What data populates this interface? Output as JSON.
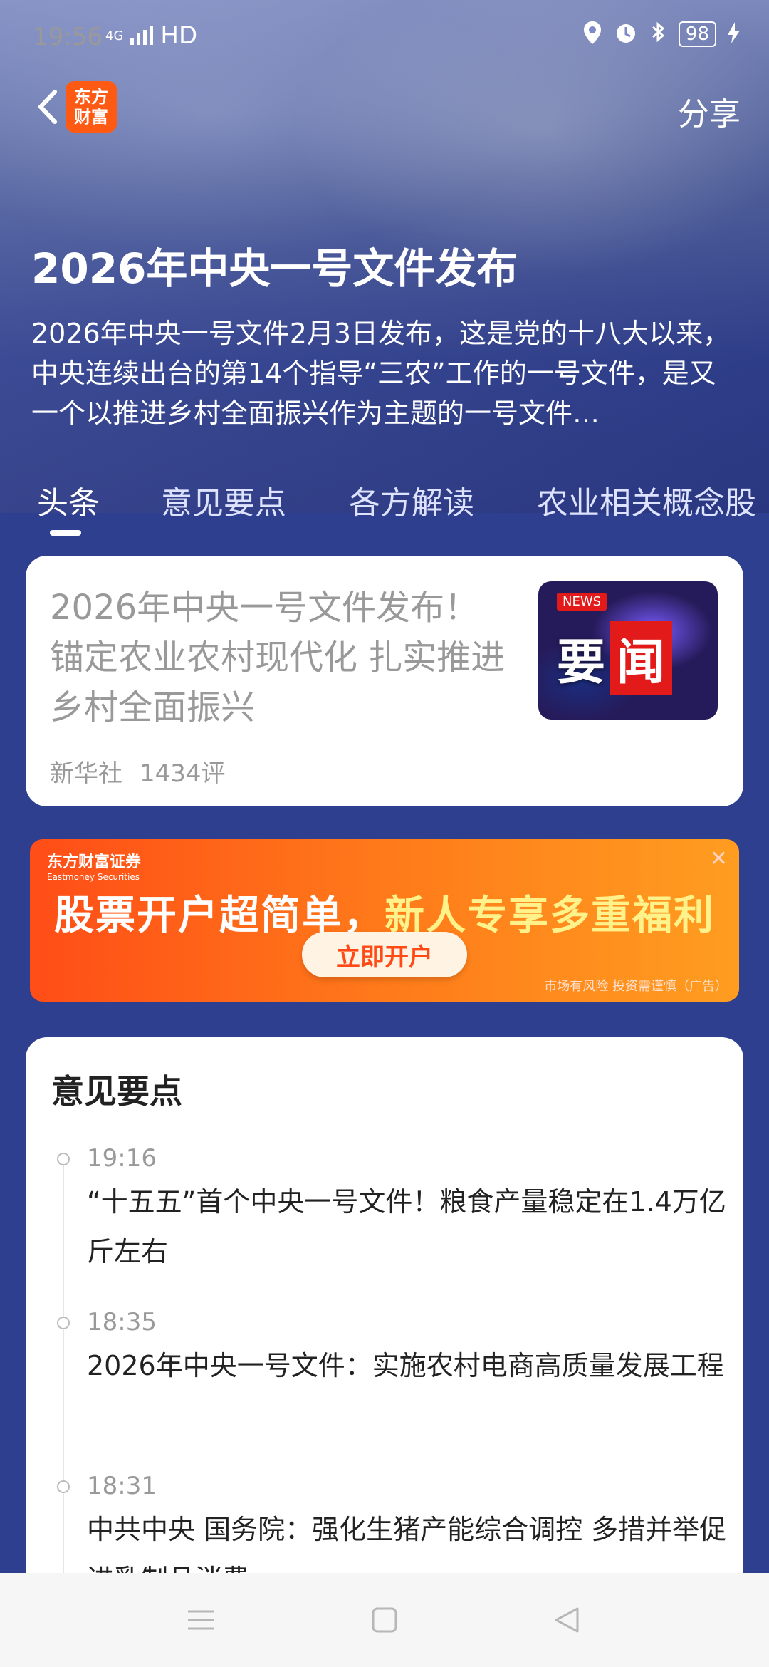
{
  "status": {
    "time": "19:56",
    "network": "4G",
    "hd": "HD",
    "battery": "98"
  },
  "header": {
    "logo_text": "东方\n财富",
    "share": "分享"
  },
  "hero": {
    "title": "2026年中央一号文件发布",
    "summary": "2026年中央一号文件2月3日发布，这是党的十八大以来，中央连续出台的第14个指导“三农”工作的一号文件，是又一个以推进乡村全面振兴作为主题的一号文件…"
  },
  "tabs": [
    {
      "label": "头条"
    },
    {
      "label": "意见要点"
    },
    {
      "label": "各方解读"
    },
    {
      "label": "农业相关概念股"
    }
  ],
  "news_card": {
    "title": "2026年中央一号文件发布！锚定农业农村现代化 扎实推进乡村全面振兴",
    "source": "新华社",
    "comments": "1434评",
    "thumb": {
      "badge": "NEWS",
      "char1": "要",
      "char2": "闻"
    }
  },
  "ad": {
    "brand": "东方财富证券",
    "brand_en": "Eastmoney Securities",
    "headline_part1": "股票开户超简单，",
    "headline_part2": "新人专享多重福利",
    "button": "立即开户",
    "disclaimer": "市场有风险 投资需谨慎（广告）",
    "close": "✕"
  },
  "key_points": {
    "title": "意见要点",
    "items": [
      {
        "time": "19:16",
        "text": "“十五五”首个中央一号文件！粮食产量稳定在1.4万亿斤左右"
      },
      {
        "time": "18:35",
        "text": "2026年中央一号文件：实施农村电商高质量发展工程"
      },
      {
        "time": "18:31",
        "text": "中共中央 国务院：强化生猪产能综合调控 多措并举促进乳制品消费"
      }
    ]
  },
  "colors": {
    "accent": "#ff5a14",
    "brand_bg": "#2f3f8f"
  },
  "icons": {
    "back": "chevron-left-icon",
    "location": "location-icon",
    "alarm": "alarm-icon",
    "bluetooth": "bluetooth-icon",
    "charging": "charging-icon",
    "menu": "menu-icon",
    "home": "home-icon",
    "back_nav": "back-triangle-icon"
  }
}
